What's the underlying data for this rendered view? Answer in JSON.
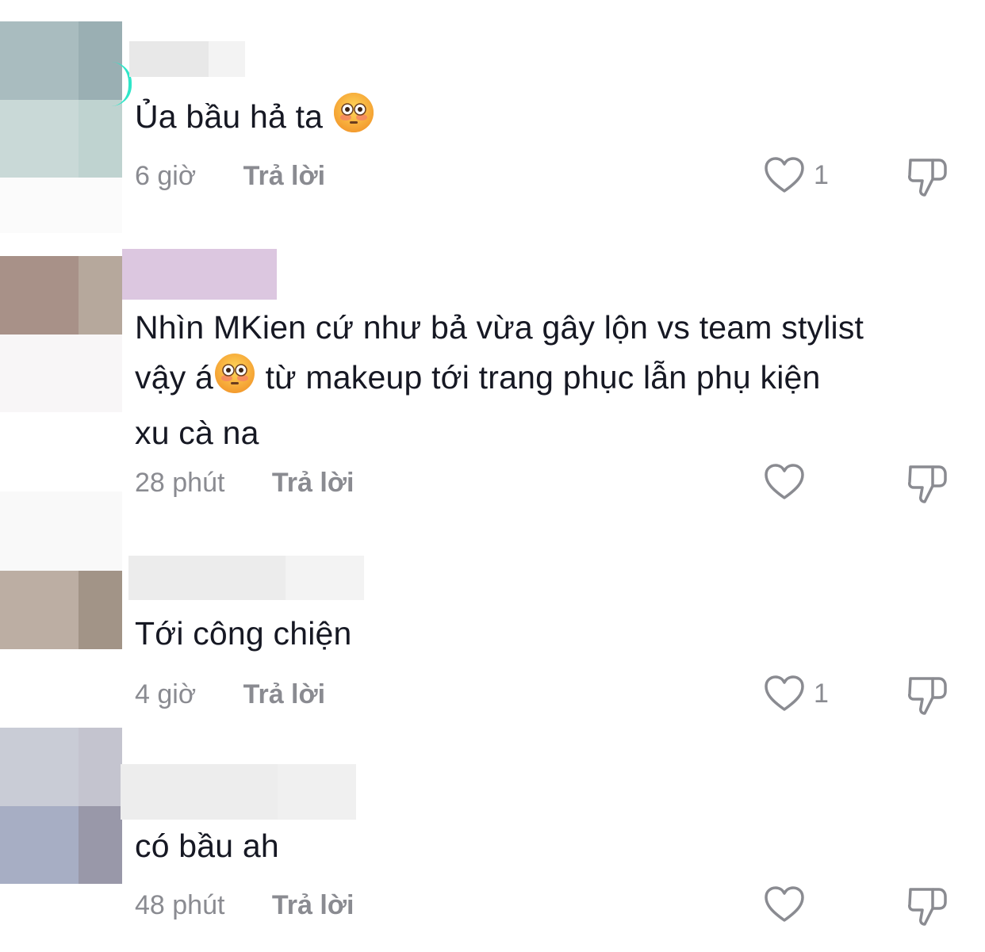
{
  "comments": [
    {
      "text_before_emoji": "Ủa bầu hả ta ",
      "emoji": "flushed-face",
      "text_after_emoji": "",
      "time": "6 giờ",
      "reply_label": "Trả lời",
      "likes": "1"
    },
    {
      "text_line1": "Nhìn MKien cứ như bả vừa gây lộn vs team stylist",
      "text_line2_before": "vậy á",
      "emoji": "flushed-face",
      "text_line2_after": " từ makeup tới trang phục lẫn phụ kiện",
      "text_line3": "xu cà na",
      "time": "28 phút",
      "reply_label": "Trả lời",
      "likes": ""
    },
    {
      "text": "Tới công chiện",
      "time": "4 giờ",
      "reply_label": "Trả lời",
      "likes": "1"
    },
    {
      "text": "có bầu ah",
      "time": "48 phút",
      "reply_label": "Trả lời",
      "likes": ""
    }
  ],
  "icons": {
    "like": "heart-outline-icon",
    "dislike": "thumbs-down-outline-icon"
  },
  "colors": {
    "text": "#161823",
    "meta": "#8a8b91",
    "ring": "#2ee6c9"
  }
}
